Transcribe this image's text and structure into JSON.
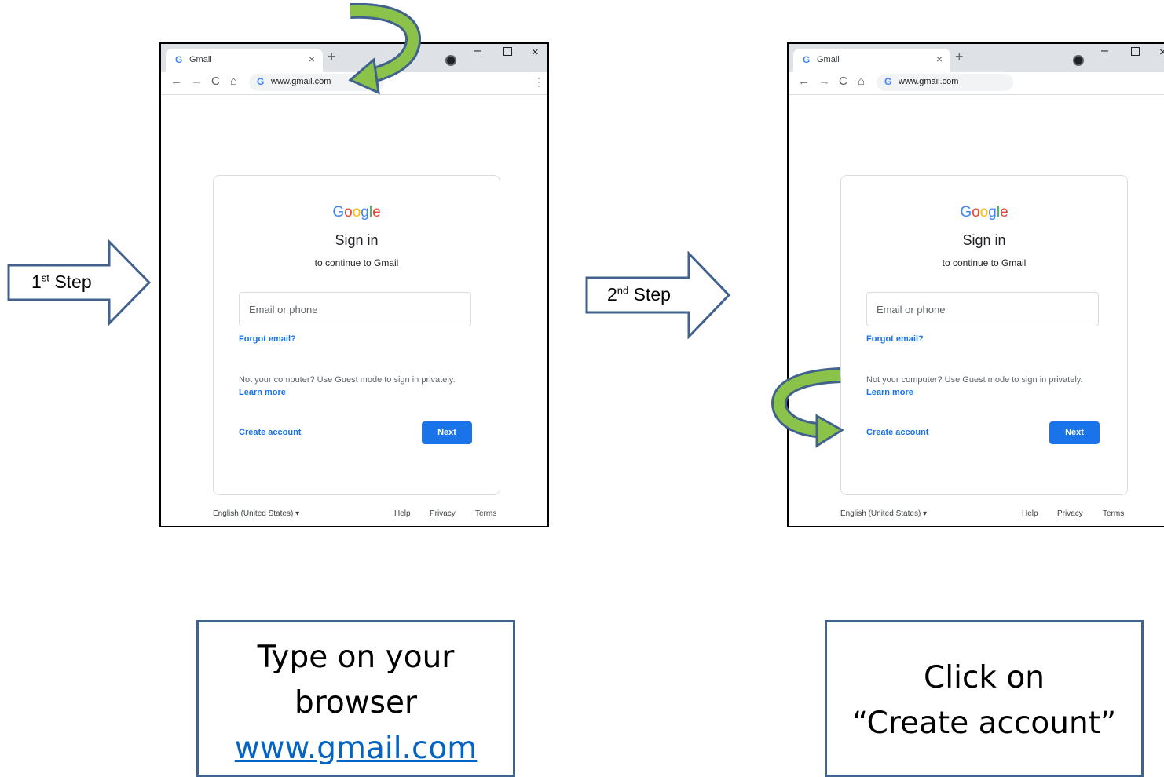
{
  "browser": {
    "tab_title": "Gmail",
    "tab_favicon": "G",
    "tab_close": "×",
    "new_tab": "+",
    "url": "www.gmail.com",
    "omnibox_icon": "G",
    "nav_back": "←",
    "nav_forward": "→",
    "nav_reload": "C",
    "nav_home": "⌂",
    "menu": "⋮",
    "win_min": "–",
    "win_close": "×"
  },
  "signin": {
    "title": "Sign in",
    "subtitle": "to continue to Gmail",
    "email_placeholder": "Email or phone",
    "forgot_email": "Forgot email?",
    "guest_text": "Not your computer? Use Guest mode to sign in privately.",
    "learn_more": "Learn more",
    "create_account": "Create account",
    "next": "Next"
  },
  "footer": {
    "language": "English (United States)",
    "language_caret": "▾",
    "help": "Help",
    "privacy": "Privacy",
    "terms": "Terms"
  },
  "google_logo": [
    "G",
    "o",
    "o",
    "g",
    "l",
    "e"
  ],
  "steps": {
    "step1": {
      "num": "1",
      "sup": "st",
      "word": "Step"
    },
    "step2": {
      "num": "2",
      "sup": "nd",
      "word": "Step"
    }
  },
  "captions": {
    "caption1_line1": "Type on your",
    "caption1_line2": "browser",
    "caption1_link": "www.gmail.com",
    "caption2_line1": "Click on",
    "caption2_line2": "“Create account”"
  },
  "colors": {
    "arrow_outline": "#41628d",
    "curved_arrow_fill": "#8bc34a",
    "curved_arrow_dark": "#5b8f2f",
    "button_blue": "#1a73e8",
    "logo": [
      "#4285f4",
      "#ea4335",
      "#fbbc05",
      "#4285f4",
      "#34a853",
      "#ea4335"
    ]
  }
}
